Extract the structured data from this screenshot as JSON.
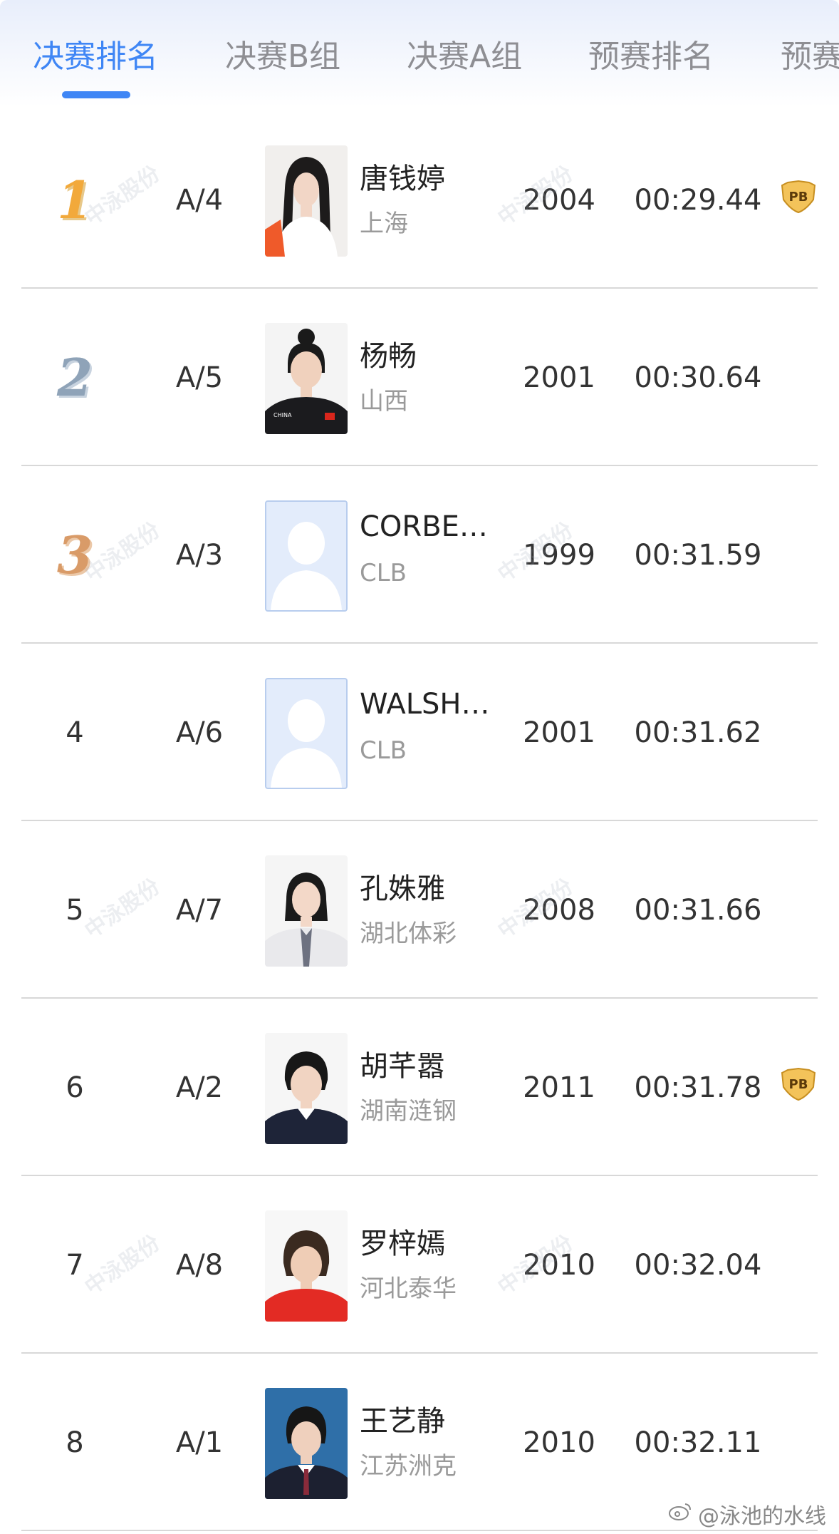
{
  "tabs": [
    {
      "label": "决赛排名",
      "active": true
    },
    {
      "label": "决赛B组",
      "active": false
    },
    {
      "label": "决赛A组",
      "active": false
    },
    {
      "label": "预赛排名",
      "active": false
    },
    {
      "label": "预赛",
      "active": false
    }
  ],
  "colors": {
    "accent": "#3f86f5",
    "gold": "#f2a93b",
    "silver": "#8fa3b8",
    "bronze": "#d99b68"
  },
  "rows": [
    {
      "rank": "1",
      "lane": "A/4",
      "name": "唐钱婷",
      "team": "上海",
      "year": "2004",
      "time": "00:29.44",
      "pb": "PB",
      "medal": "gold",
      "photo": "athlete-photo"
    },
    {
      "rank": "2",
      "lane": "A/5",
      "name": "杨畅",
      "team": "山西",
      "year": "2001",
      "time": "00:30.64",
      "pb": "",
      "medal": "silver",
      "photo": "athlete-photo"
    },
    {
      "rank": "3",
      "lane": "A/3",
      "name": "CORBE…",
      "team": "CLB",
      "year": "1999",
      "time": "00:31.59",
      "pb": "",
      "medal": "bronze",
      "photo": "placeholder-avatar"
    },
    {
      "rank": "4",
      "lane": "A/6",
      "name": "WALSH…",
      "team": "CLB",
      "year": "2001",
      "time": "00:31.62",
      "pb": "",
      "medal": "",
      "photo": "placeholder-avatar"
    },
    {
      "rank": "5",
      "lane": "A/7",
      "name": "孔姝雅",
      "team": "湖北体彩",
      "year": "2008",
      "time": "00:31.66",
      "pb": "",
      "medal": "",
      "photo": "athlete-photo"
    },
    {
      "rank": "6",
      "lane": "A/2",
      "name": "胡芊嚣",
      "team": "湖南涟钢",
      "year": "2011",
      "time": "00:31.78",
      "pb": "PB",
      "medal": "",
      "photo": "athlete-photo"
    },
    {
      "rank": "7",
      "lane": "A/8",
      "name": "罗梓嫣",
      "team": "河北泰华",
      "year": "2010",
      "time": "00:32.04",
      "pb": "",
      "medal": "",
      "photo": "athlete-photo"
    },
    {
      "rank": "8",
      "lane": "A/1",
      "name": "王艺静",
      "team": "江苏洲克",
      "year": "2010",
      "time": "00:32.11",
      "pb": "",
      "medal": "",
      "photo": "athlete-photo"
    }
  ],
  "watermark": {
    "text": "中泳股份"
  },
  "footer": {
    "handle": "@泳池的水线"
  }
}
